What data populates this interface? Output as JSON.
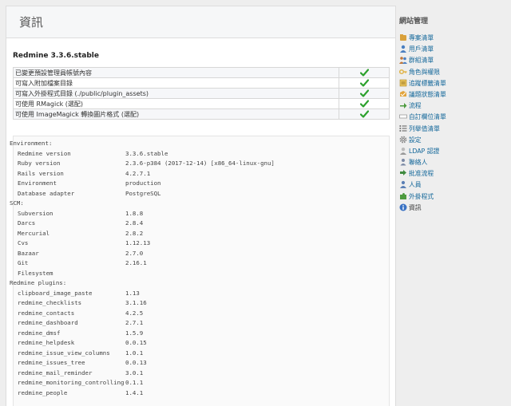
{
  "page": {
    "title": "資訊"
  },
  "version_heading": "Redmine 3.3.6.stable",
  "checks": [
    {
      "label": "已變更預設管理員帳號內容",
      "status": "ok"
    },
    {
      "label": "可寫入附加檔案目錄",
      "status": "ok"
    },
    {
      "label": "可寫入外掛程式目錄 (./public/plugin_assets)",
      "status": "ok"
    },
    {
      "label": "可使用 RMagick (選配)",
      "status": "ok"
    },
    {
      "label": "可使用 ImageMagick 轉換圖片格式 (選配)",
      "status": "ok"
    }
  ],
  "environment": {
    "header": "Environment:",
    "rows": [
      {
        "key": "Redmine version",
        "value": "3.3.6.stable"
      },
      {
        "key": "Ruby version",
        "value": "2.3.6-p384 (2017-12-14) [x86_64-linux-gnu]"
      },
      {
        "key": "Rails version",
        "value": "4.2.7.1"
      },
      {
        "key": "Environment",
        "value": "production"
      },
      {
        "key": "Database adapter",
        "value": "PostgreSQL"
      }
    ]
  },
  "scm": {
    "header": "SCM:",
    "rows": [
      {
        "key": "Subversion",
        "value": "1.8.8"
      },
      {
        "key": "Darcs",
        "value": "2.8.4"
      },
      {
        "key": "Mercurial",
        "value": "2.8.2"
      },
      {
        "key": "Cvs",
        "value": "1.12.13"
      },
      {
        "key": "Bazaar",
        "value": "2.7.0"
      },
      {
        "key": "Git",
        "value": "2.16.1"
      },
      {
        "key": "Filesystem",
        "value": ""
      }
    ]
  },
  "plugins": {
    "header": "Redmine plugins:",
    "rows": [
      {
        "key": "clipboard_image_paste",
        "value": "1.13"
      },
      {
        "key": "redmine_checklists",
        "value": "3.1.16"
      },
      {
        "key": "redmine_contacts",
        "value": "4.2.5"
      },
      {
        "key": "redmine_dashboard",
        "value": "2.7.1"
      },
      {
        "key": "redmine_dmsf",
        "value": "1.5.9"
      },
      {
        "key": "redmine_helpdesk",
        "value": "0.0.15"
      },
      {
        "key": "redmine_issue_view_columns",
        "value": "1.0.1"
      },
      {
        "key": "redmine_issues_tree",
        "value": "0.0.13"
      },
      {
        "key": "redmine_mail_reminder",
        "value": "3.0.1"
      },
      {
        "key": "redmine_monitoring_controlling",
        "value": "0.1.1"
      },
      {
        "key": "redmine_people",
        "value": "1.4.1"
      }
    ]
  },
  "sidebar": {
    "title": "網站管理",
    "items": [
      {
        "label": "專案清單",
        "icon": "projects-icon",
        "color": "#d9a03a"
      },
      {
        "label": "用戶清單",
        "icon": "users-icon",
        "color": "#4a7fc1"
      },
      {
        "label": "群組清單",
        "icon": "groups-icon",
        "color": "#c0763a"
      },
      {
        "label": "角色與權限",
        "icon": "roles-icon",
        "color": "#e0b54a"
      },
      {
        "label": "追蹤標籤清單",
        "icon": "trackers-icon",
        "color": "#e8c25a"
      },
      {
        "label": "議題狀態清單",
        "icon": "issue-statuses-icon",
        "color": "#e2a43c"
      },
      {
        "label": "流程",
        "icon": "workflow-icon",
        "color": "#4d9a3f"
      },
      {
        "label": "自訂欄位清單",
        "icon": "custom-fields-icon",
        "color": "#9a9a9a"
      },
      {
        "label": "列舉值清單",
        "icon": "enumerations-icon",
        "color": "#5a5a5a"
      },
      {
        "label": "設定",
        "icon": "settings-icon",
        "color": "#888888"
      },
      {
        "label": "LDAP 認證",
        "icon": "ldap-icon",
        "color": "#999999"
      },
      {
        "label": "聯絡人",
        "icon": "contacts-icon",
        "color": "#7c8aa5"
      },
      {
        "label": "批准流程",
        "icon": "approval-workflow-icon",
        "color": "#3f8a3f"
      },
      {
        "label": "人員",
        "icon": "people-icon",
        "color": "#5a7fb5"
      },
      {
        "label": "外掛程式",
        "icon": "plugins-icon",
        "color": "#4d9a3f"
      },
      {
        "label": "資訊",
        "icon": "info-icon",
        "color": "#3a72c4",
        "selected": true
      }
    ]
  },
  "colors": {
    "check": "#2da12d",
    "link": "#116699"
  }
}
